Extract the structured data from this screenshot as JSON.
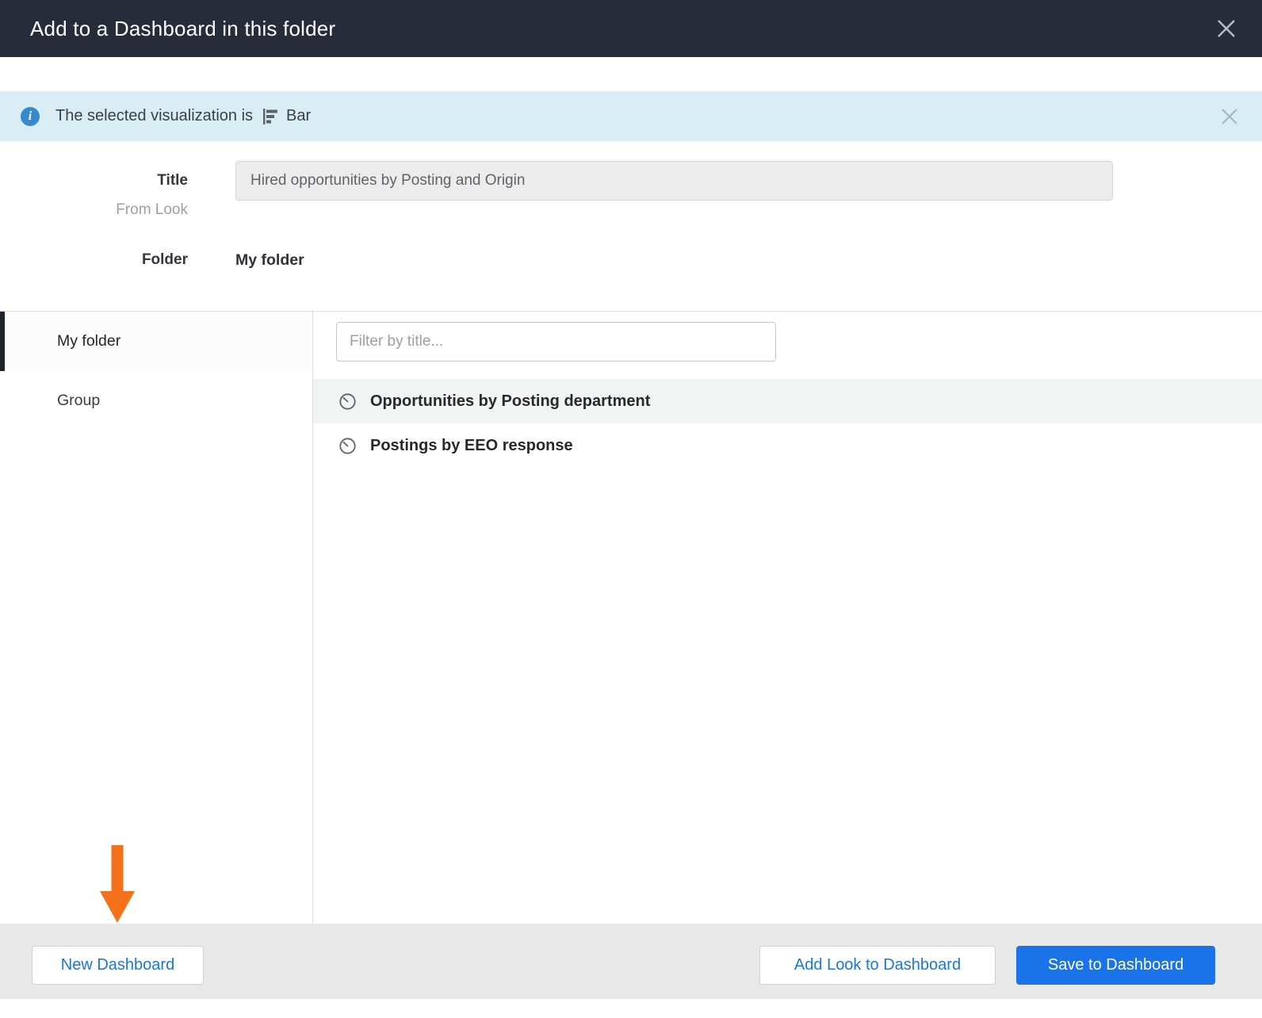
{
  "header": {
    "title": "Add to a Dashboard in this folder"
  },
  "banner": {
    "text_prefix": "The selected visualization is",
    "viz_name": "Bar",
    "info_icon": "info-circle",
    "viz_icon": "horizontal-bar-chart"
  },
  "form": {
    "title_label": "Title",
    "title_sublabel": "From Look",
    "title_value": "Hired opportunities by Posting and Origin",
    "folder_label": "Folder",
    "folder_value": "My folder"
  },
  "sidebar": {
    "items": [
      {
        "label": "My folder",
        "selected": true
      },
      {
        "label": "Group",
        "selected": false
      }
    ]
  },
  "content": {
    "filter_placeholder": "Filter by title...",
    "dashboards": [
      {
        "label": "Opportunities by Posting department",
        "icon": "gauge-dashboard",
        "selected": true
      },
      {
        "label": "Postings by EEO response",
        "icon": "gauge-dashboard",
        "selected": false
      }
    ]
  },
  "footer": {
    "new_dashboard_label": "New Dashboard",
    "add_look_label": "Add Look to Dashboard",
    "save_label": "Save to Dashboard"
  },
  "annotation": {
    "arrow": "orange down arrow pointing at New Dashboard button"
  },
  "colors": {
    "header_bg": "#262c3a",
    "banner_bg": "#d9edf4",
    "accent_blue": "#1a73e8",
    "arrow_orange": "#f4711b",
    "selected_row_bg": "#f2f3f3",
    "footer_bg": "#e8e8e8"
  }
}
